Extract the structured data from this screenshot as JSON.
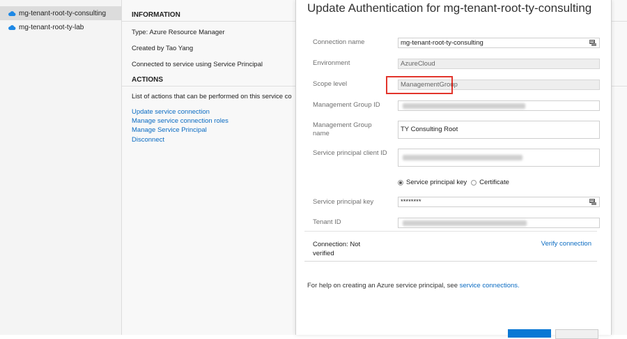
{
  "sidebar": {
    "items": [
      {
        "label": "mg-tenant-root-ty-consulting",
        "icon": "cloud-icon",
        "selected": true
      },
      {
        "label": "mg-tenant-root-ty-lab",
        "icon": "cloud-icon",
        "selected": false
      }
    ]
  },
  "main": {
    "information_heading": "INFORMATION",
    "type_text": "Type: Azure Resource Manager",
    "created_text": "Created by Tao Yang",
    "connected_text": "Connected to service using Service Principal",
    "actions_heading": "ACTIONS",
    "actions_desc": "List of actions that can be performed on this service co",
    "actions": [
      "Update service connection",
      "Manage service connection roles",
      "Manage Service Principal",
      "Disconnect"
    ]
  },
  "dialog": {
    "title": "Update Authentication for mg-tenant-root-ty-consulting",
    "connection_name_label": "Connection name",
    "connection_name_value": "mg-tenant-root-ty-consulting",
    "environment_label": "Environment",
    "environment_value": "AzureCloud",
    "scope_level_label": "Scope level",
    "scope_level_value": "ManagementGroup",
    "mg_id_label": "Management Group ID",
    "mg_name_label": "Management Group name",
    "mg_name_value": "TY Consulting Root",
    "sp_client_id_label": "Service principal client ID",
    "radio_sp_key_label": "Service principal key",
    "radio_certificate_label": "Certificate",
    "sp_key_label": "Service principal key",
    "sp_key_value": "********",
    "tenant_id_label": "Tenant ID",
    "connection_status": "Connection: Not verified",
    "verify_link": "Verify connection",
    "help_text": "For help on creating an Azure service principal, see ",
    "help_link": "service connections.",
    "colors": {
      "accent": "#0a78d4",
      "link": "#0a6bc2",
      "highlight": "#e2342b"
    }
  }
}
